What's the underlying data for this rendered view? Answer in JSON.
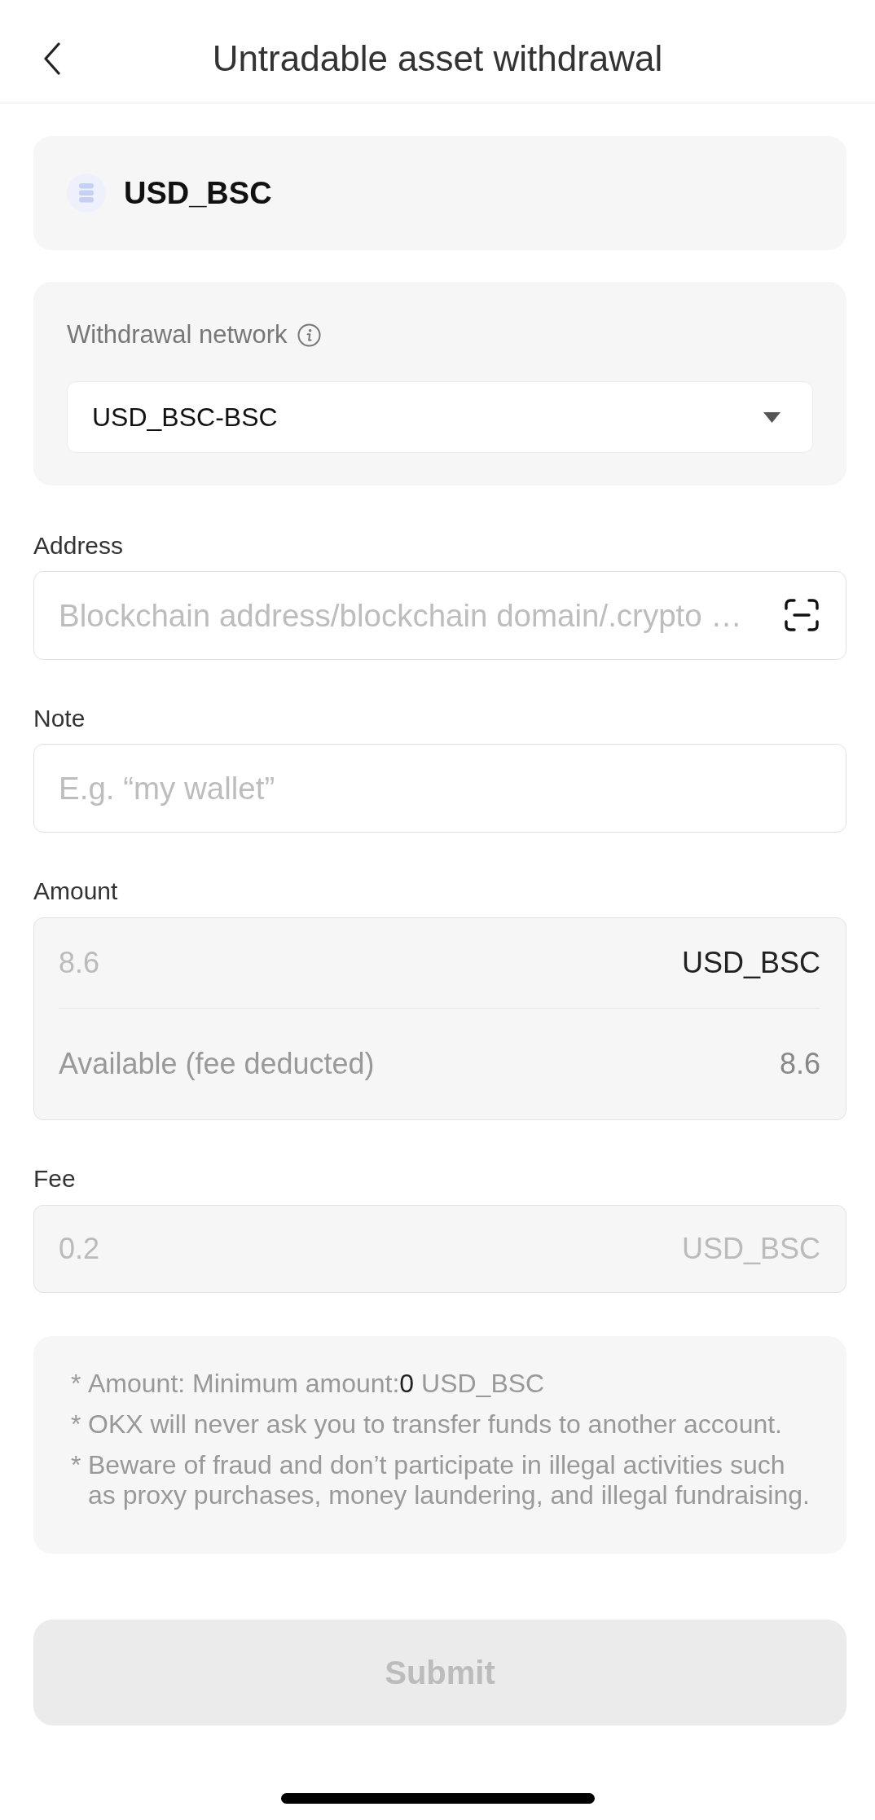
{
  "header": {
    "title": "Untradable asset withdrawal"
  },
  "coin": {
    "symbol": "USD_BSC"
  },
  "network": {
    "label": "Withdrawal network",
    "value": "USD_BSC-BSC"
  },
  "address": {
    "label": "Address",
    "placeholder": "Blockchain address/blockchain domain/.crypto …"
  },
  "note": {
    "label": "Note",
    "placeholder": "E.g. “my wallet”"
  },
  "amount": {
    "label": "Amount",
    "value": "8.6",
    "unit": "USD_BSC",
    "disabled": true,
    "available_label": "Available (fee deducted)",
    "available_value": "8.6"
  },
  "fee": {
    "label": "Fee",
    "value": "0.2",
    "unit": "USD_BSC",
    "disabled": true
  },
  "notices": [
    {
      "marker": "*",
      "text": "Amount: Minimum amount:**0** USD_BSC"
    },
    {
      "marker": "*",
      "text": "OKX will never ask you to transfer funds to another account."
    },
    {
      "marker": "*",
      "text": "Beware of fraud and don’t participate in illegal activities such as proxy purchases, money laundering, and illegal fundraising."
    }
  ],
  "submit": {
    "label": "Submit",
    "disabled": true
  }
}
